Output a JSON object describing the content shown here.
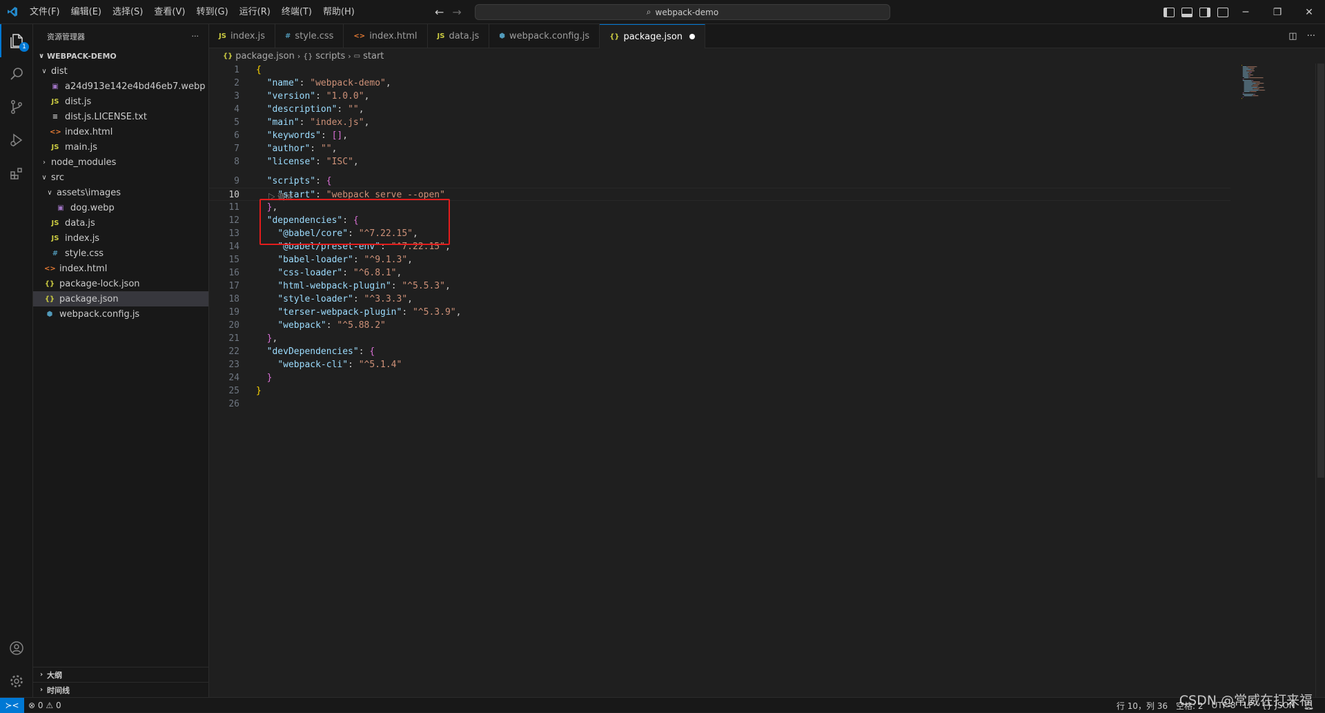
{
  "titlebar": {
    "menu": [
      "文件(F)",
      "编辑(E)",
      "选择(S)",
      "查看(V)",
      "转到(G)",
      "运行(R)",
      "终端(T)",
      "帮助(H)"
    ],
    "search": "webpack-demo"
  },
  "activity": {
    "explorer_badge": "1"
  },
  "sidebar": {
    "title": "资源管理器",
    "more": "···",
    "project": "WEBPACK-DEMO",
    "tree": [
      {
        "label": "dist",
        "type": "folder",
        "open": true,
        "depth": 0
      },
      {
        "label": "a24d913e142e4bd46eb7.webp",
        "type": "image",
        "depth": 1
      },
      {
        "label": "dist.js",
        "type": "js",
        "depth": 1
      },
      {
        "label": "dist.js.LICENSE.txt",
        "type": "txt",
        "depth": 1
      },
      {
        "label": "index.html",
        "type": "html",
        "depth": 1
      },
      {
        "label": "main.js",
        "type": "js",
        "depth": 1
      },
      {
        "label": "node_modules",
        "type": "folder",
        "open": false,
        "depth": 0
      },
      {
        "label": "src",
        "type": "folder",
        "open": true,
        "depth": 0
      },
      {
        "label": "assets\\images",
        "type": "folder",
        "open": true,
        "depth": 1
      },
      {
        "label": "dog.webp",
        "type": "image",
        "depth": 2
      },
      {
        "label": "data.js",
        "type": "js",
        "depth": 1
      },
      {
        "label": "index.js",
        "type": "js",
        "depth": 1
      },
      {
        "label": "style.css",
        "type": "css",
        "depth": 1
      },
      {
        "label": "index.html",
        "type": "html",
        "depth": 0
      },
      {
        "label": "package-lock.json",
        "type": "json",
        "depth": 0
      },
      {
        "label": "package.json",
        "type": "json",
        "depth": 0,
        "selected": true
      },
      {
        "label": "webpack.config.js",
        "type": "webpack",
        "depth": 0
      }
    ],
    "outline": "大纲",
    "timeline": "时间线"
  },
  "tabs": [
    {
      "label": "index.js",
      "icon": "JS",
      "color": "#cbcb41"
    },
    {
      "label": "style.css",
      "icon": "#",
      "color": "#519aba"
    },
    {
      "label": "index.html",
      "icon": "<>",
      "color": "#e37933"
    },
    {
      "label": "data.js",
      "icon": "JS",
      "color": "#cbcb41"
    },
    {
      "label": "webpack.config.js",
      "icon": "⬢",
      "color": "#519aba"
    },
    {
      "label": "package.json",
      "icon": "{}",
      "color": "#cbcb41",
      "active": true
    }
  ],
  "breadcrumb": [
    "package.json",
    "scripts",
    "start"
  ],
  "codelens": "▷ 调试",
  "code": [
    [
      [
        "b1",
        "{"
      ]
    ],
    [
      [
        "p",
        "  "
      ],
      [
        "k",
        "\"name\""
      ],
      [
        "p",
        ": "
      ],
      [
        "s",
        "\"webpack-demo\""
      ],
      [
        "p",
        ","
      ]
    ],
    [
      [
        "p",
        "  "
      ],
      [
        "k",
        "\"version\""
      ],
      [
        "p",
        ": "
      ],
      [
        "s",
        "\"1.0.0\""
      ],
      [
        "p",
        ","
      ]
    ],
    [
      [
        "p",
        "  "
      ],
      [
        "k",
        "\"description\""
      ],
      [
        "p",
        ": "
      ],
      [
        "s",
        "\"\""
      ],
      [
        "p",
        ","
      ]
    ],
    [
      [
        "p",
        "  "
      ],
      [
        "k",
        "\"main\""
      ],
      [
        "p",
        ": "
      ],
      [
        "s",
        "\"index.js\""
      ],
      [
        "p",
        ","
      ]
    ],
    [
      [
        "p",
        "  "
      ],
      [
        "k",
        "\"keywords\""
      ],
      [
        "p",
        ": "
      ],
      [
        "b2",
        "[]"
      ],
      [
        "p",
        ","
      ]
    ],
    [
      [
        "p",
        "  "
      ],
      [
        "k",
        "\"author\""
      ],
      [
        "p",
        ": "
      ],
      [
        "s",
        "\"\""
      ],
      [
        "p",
        ","
      ]
    ],
    [
      [
        "p",
        "  "
      ],
      [
        "k",
        "\"license\""
      ],
      [
        "p",
        ": "
      ],
      [
        "s",
        "\"ISC\""
      ],
      [
        "p",
        ","
      ]
    ],
    [
      [
        "p",
        "  "
      ],
      [
        "k",
        "\"scripts\""
      ],
      [
        "p",
        ": "
      ],
      [
        "b2",
        "{"
      ]
    ],
    [
      [
        "p",
        "    "
      ],
      [
        "k",
        "\"start\""
      ],
      [
        "p",
        ": "
      ],
      [
        "s",
        "\"webpack serve --open\""
      ]
    ],
    [
      [
        "p",
        "  "
      ],
      [
        "b2",
        "}"
      ],
      [
        "p",
        ","
      ]
    ],
    [
      [
        "p",
        "  "
      ],
      [
        "k",
        "\"dependencies\""
      ],
      [
        "p",
        ": "
      ],
      [
        "b2",
        "{"
      ]
    ],
    [
      [
        "p",
        "    "
      ],
      [
        "k",
        "\"@babel/core\""
      ],
      [
        "p",
        ": "
      ],
      [
        "s",
        "\"^7.22.15\""
      ],
      [
        "p",
        ","
      ]
    ],
    [
      [
        "p",
        "    "
      ],
      [
        "k",
        "\"@babel/preset-env\""
      ],
      [
        "p",
        ": "
      ],
      [
        "s",
        "\"^7.22.15\""
      ],
      [
        "p",
        ","
      ]
    ],
    [
      [
        "p",
        "    "
      ],
      [
        "k",
        "\"babel-loader\""
      ],
      [
        "p",
        ": "
      ],
      [
        "s",
        "\"^9.1.3\""
      ],
      [
        "p",
        ","
      ]
    ],
    [
      [
        "p",
        "    "
      ],
      [
        "k",
        "\"css-loader\""
      ],
      [
        "p",
        ": "
      ],
      [
        "s",
        "\"^6.8.1\""
      ],
      [
        "p",
        ","
      ]
    ],
    [
      [
        "p",
        "    "
      ],
      [
        "k",
        "\"html-webpack-plugin\""
      ],
      [
        "p",
        ": "
      ],
      [
        "s",
        "\"^5.5.3\""
      ],
      [
        "p",
        ","
      ]
    ],
    [
      [
        "p",
        "    "
      ],
      [
        "k",
        "\"style-loader\""
      ],
      [
        "p",
        ": "
      ],
      [
        "s",
        "\"^3.3.3\""
      ],
      [
        "p",
        ","
      ]
    ],
    [
      [
        "p",
        "    "
      ],
      [
        "k",
        "\"terser-webpack-plugin\""
      ],
      [
        "p",
        ": "
      ],
      [
        "s",
        "\"^5.3.9\""
      ],
      [
        "p",
        ","
      ]
    ],
    [
      [
        "p",
        "    "
      ],
      [
        "k",
        "\"webpack\""
      ],
      [
        "p",
        ": "
      ],
      [
        "s",
        "\"^5.88.2\""
      ]
    ],
    [
      [
        "p",
        "  "
      ],
      [
        "b2",
        "}"
      ],
      [
        "p",
        ","
      ]
    ],
    [
      [
        "p",
        "  "
      ],
      [
        "k",
        "\"devDependencies\""
      ],
      [
        "p",
        ": "
      ],
      [
        "b2",
        "{"
      ]
    ],
    [
      [
        "p",
        "    "
      ],
      [
        "k",
        "\"webpack-cli\""
      ],
      [
        "p",
        ": "
      ],
      [
        "s",
        "\"^5.1.4\""
      ]
    ],
    [
      [
        "p",
        "  "
      ],
      [
        "b2",
        "}"
      ]
    ],
    [
      [
        "b1",
        "}"
      ]
    ],
    []
  ],
  "current_line": 10,
  "status": {
    "errors": "0",
    "warnings": "0",
    "position": "行 10，列 36",
    "spaces": "空格: 2",
    "encoding": "UTF-8",
    "eol": "LF",
    "language": "JSON"
  },
  "watermark": "CSDN @常威在打来福"
}
